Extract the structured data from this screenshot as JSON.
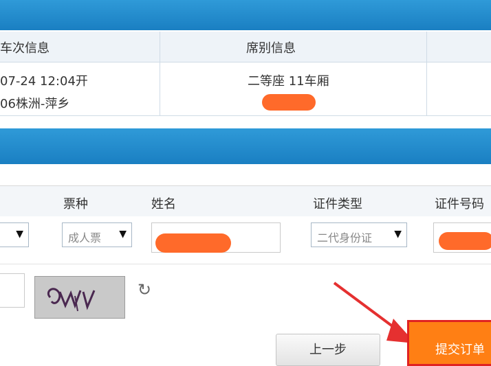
{
  "train_table": {
    "headers": [
      "车次信息",
      "席别信息"
    ],
    "row": {
      "date_time": "07-24 12:04开",
      "route": "06株洲-萍乡",
      "seat": "二等座 11车厢"
    }
  },
  "passenger_table": {
    "headers": {
      "ticket_type": "票种",
      "name": "姓名",
      "id_type": "证件类型",
      "id_number": "证件号码"
    },
    "ticket_type_value": "成人票",
    "id_type_value": "二代身份证"
  },
  "captcha": {
    "text": "OW"
  },
  "buttons": {
    "prev": "上一步",
    "submit": "提交订单"
  },
  "colors": {
    "header_bar": "#1f88cc",
    "redaction": "#ff6a2a",
    "submit_bg": "#ff7f14",
    "highlight": "#e02222"
  }
}
